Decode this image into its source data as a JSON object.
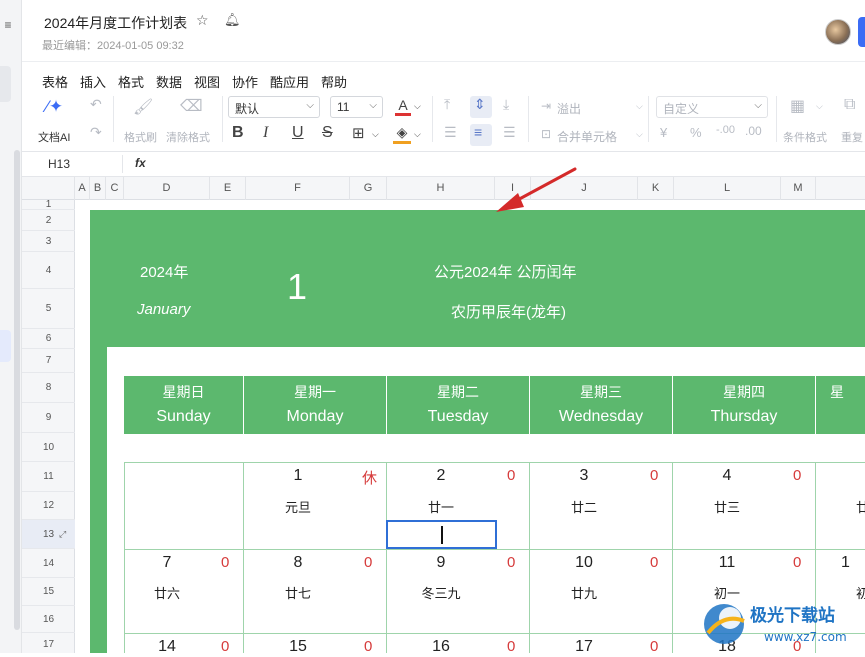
{
  "app": {
    "title": "2024年月度工作计划表",
    "subtitle": "最近编辑：2024-01-05 09:32",
    "left_icon": "≡"
  },
  "menu": [
    "表格",
    "插入",
    "格式",
    "数据",
    "视图",
    "协作",
    "酷应用",
    "帮助"
  ],
  "toolbar": {
    "ai_label": "文档AI",
    "painter_label": "格式刷",
    "clear_label": "清除格式",
    "font": "默认",
    "size": "11",
    "bold": "B",
    "italic": "I",
    "underline": "U",
    "strike": "S",
    "overflow": "溢出",
    "merge": "合并单元格",
    "number_format": "自定义",
    "currency": "¥",
    "percent": "%",
    "decimal": "-.00",
    "cond_label": "条件格式",
    "repeat_label": "重复"
  },
  "formula_bar": {
    "cell_ref": "H13",
    "fx": "fx"
  },
  "columns": [
    "A",
    "B",
    "C",
    "D",
    "E",
    "F",
    "G",
    "H",
    "I",
    "J",
    "K",
    "L",
    "M"
  ],
  "rows": [
    "1",
    "2",
    "3",
    "4",
    "5",
    "6",
    "7",
    "8",
    "9",
    "10",
    "11",
    "12",
    "13",
    "14",
    "15",
    "16",
    "17"
  ],
  "calendar": {
    "year": "2024年",
    "month_num": "1",
    "month_en": "January",
    "era": "公元2024年 公历闰年",
    "lunar": "农历甲辰年(龙年)",
    "weekdays": [
      {
        "cn": "星期日",
        "en": "Sunday"
      },
      {
        "cn": "星期一",
        "en": "Monday"
      },
      {
        "cn": "星期二",
        "en": "Tuesday"
      },
      {
        "cn": "星期三",
        "en": "Wednesday"
      },
      {
        "cn": "星期四",
        "en": "Thursday"
      },
      {
        "cn": "星",
        "en": ""
      }
    ],
    "week1": [
      {
        "day": "1",
        "count": "休",
        "lunar": "元旦"
      },
      {
        "day": "2",
        "count": "0",
        "lunar": "廿一"
      },
      {
        "day": "3",
        "count": "0",
        "lunar": "廿二"
      },
      {
        "day": "4",
        "count": "0",
        "lunar": "廿三"
      },
      {
        "day": "",
        "count": "",
        "lunar": "廿"
      }
    ],
    "week2": [
      {
        "day": "7",
        "count": "0",
        "lunar": "廿六"
      },
      {
        "day": "8",
        "count": "0",
        "lunar": "廿七"
      },
      {
        "day": "9",
        "count": "0",
        "lunar": "冬三九"
      },
      {
        "day": "10",
        "count": "0",
        "lunar": "廿九"
      },
      {
        "day": "11",
        "count": "0",
        "lunar": "初一"
      },
      {
        "day": "1",
        "count": "",
        "lunar": "初"
      }
    ],
    "week3": [
      {
        "day": "14",
        "count": "0"
      },
      {
        "day": "15",
        "count": "0"
      },
      {
        "day": "16",
        "count": "0"
      },
      {
        "day": "17",
        "count": "0"
      },
      {
        "day": "18",
        "count": "0"
      }
    ]
  },
  "watermark": {
    "text": "极光下载站",
    "url": "www.xz7.com"
  },
  "colors": {
    "green": "#5cb86e",
    "accent": "#3b6cf5",
    "red": "#d63b3b"
  }
}
